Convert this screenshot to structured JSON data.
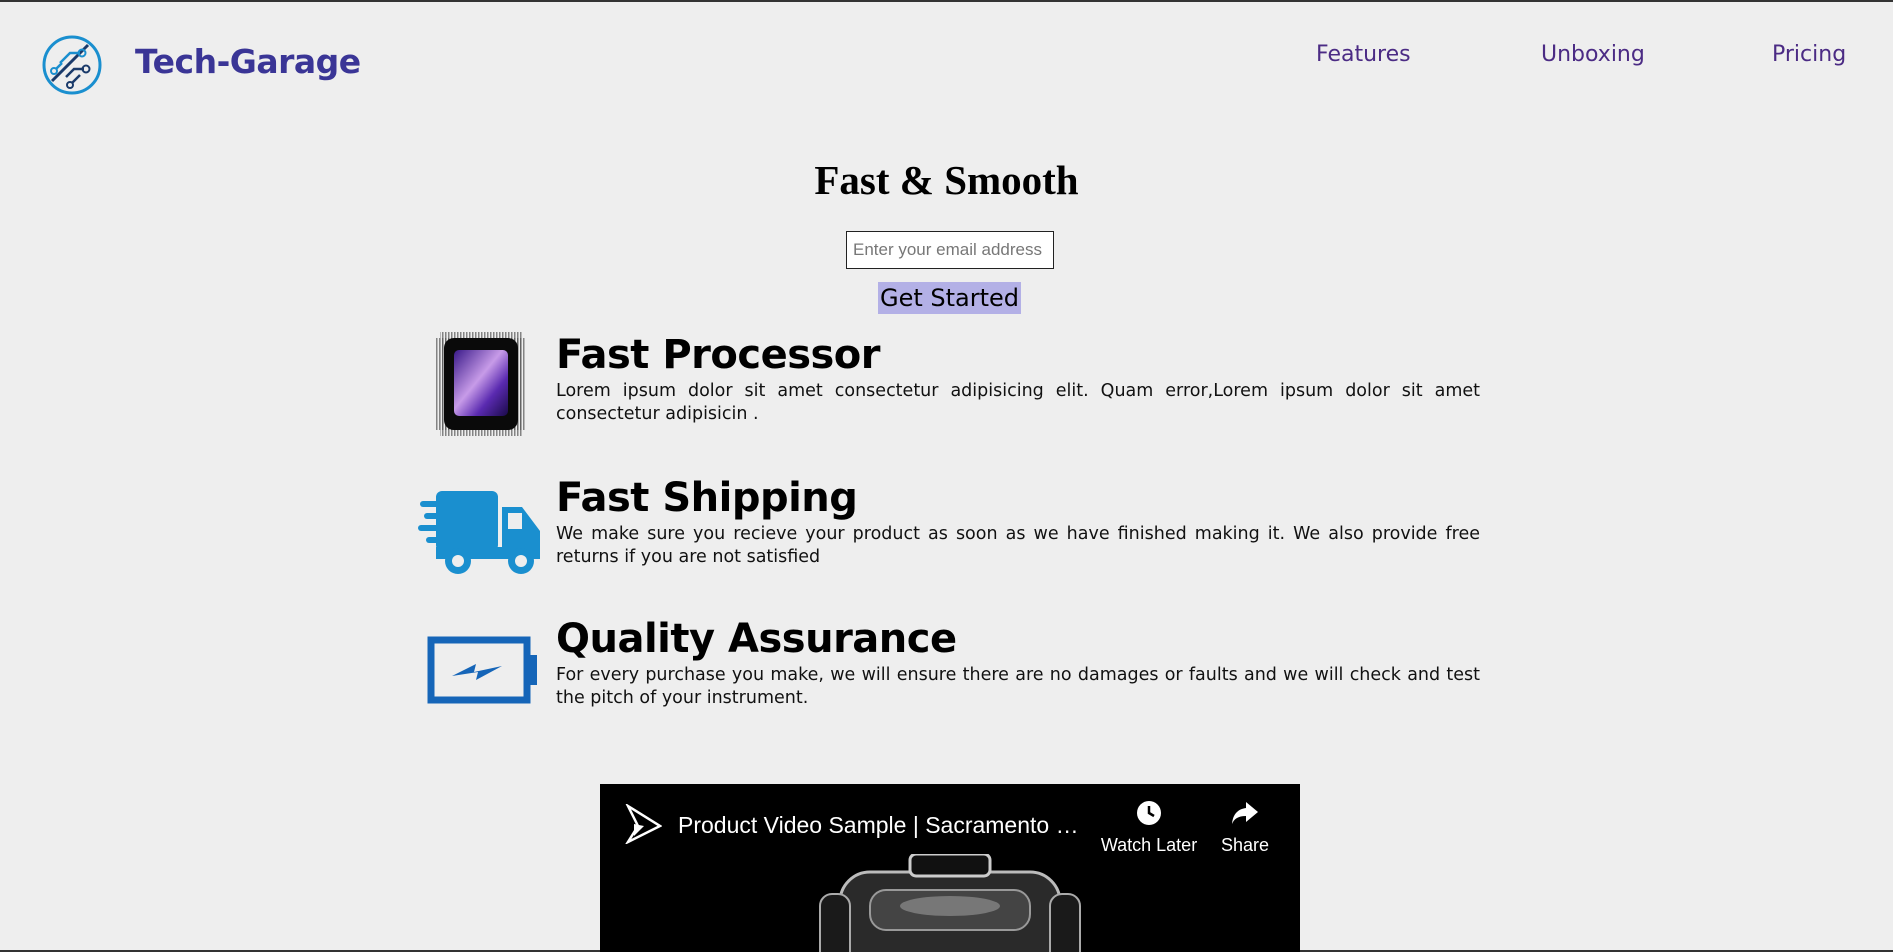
{
  "header": {
    "brand": "Tech-Garage",
    "logo_icon": "circuit-logo-icon",
    "nav": [
      {
        "label": "Features"
      },
      {
        "label": "Unboxing"
      },
      {
        "label": "Pricing"
      }
    ]
  },
  "hero": {
    "title": "Fast & Smooth",
    "email_placeholder": "Enter your email address",
    "cta_label": "Get Started"
  },
  "features": [
    {
      "icon": "processor-chip-icon",
      "heading": "Fast Processor",
      "description": "Lorem ipsum dolor sit amet consectetur adipisicing elit. Quam error,Lorem ipsum dolor sit amet consectetur adipisicin ."
    },
    {
      "icon": "delivery-truck-icon",
      "heading": "Fast Shipping",
      "description": "We make sure you recieve your product as soon as we have finished making it. We also provide free returns if you are not satisfied"
    },
    {
      "icon": "battery-charge-icon",
      "heading": "Quality Assurance",
      "description": "For every purchase you make, we will ensure there are no damages or faults and we will check and test the pitch of your instrument."
    }
  ],
  "video": {
    "title": "Product Video Sample | Sacramento Vi...",
    "watch_later_label": "Watch Later",
    "share_label": "Share"
  },
  "colors": {
    "background": "#eeeeee",
    "brand": "#3a3596",
    "nav": "#4b2b84",
    "cta": "#b3b0e6",
    "icon_blue": "#1a8fcf"
  }
}
